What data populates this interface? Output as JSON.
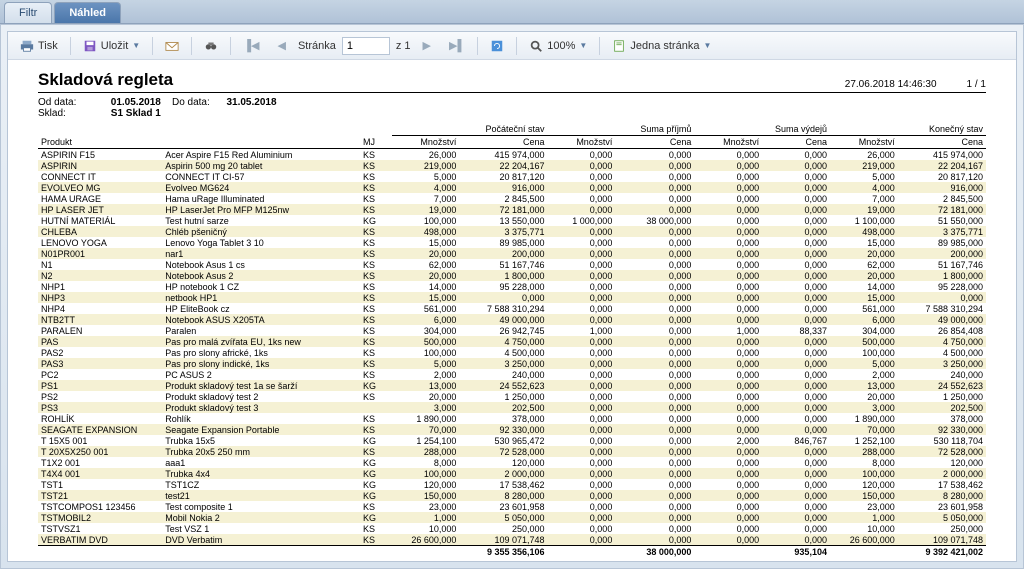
{
  "tabs": {
    "filter": "Filtr",
    "preview": "Náhled"
  },
  "toolbar": {
    "print": "Tisk",
    "save": "Uložit",
    "page_label": "Stránka",
    "page_value": "1",
    "of_label": "z 1",
    "zoom": "100%",
    "one_page": "Jedna stránka"
  },
  "report": {
    "title": "Skladová regleta",
    "generated": "27.06.2018 14:46:30",
    "pageinfo": "1 / 1",
    "meta": {
      "from_lbl": "Od data:",
      "from_val": "01.05.2018",
      "to_lbl": "Do data:",
      "to_val": "31.05.2018",
      "warehouse_lbl": "Sklad:",
      "warehouse_val": "S1 Sklad 1"
    },
    "groups": {
      "open": "Počáteční stav",
      "in": "Suma příjmů",
      "out": "Suma výdejů",
      "close": "Konečný stav"
    },
    "cols": {
      "product": "Produkt",
      "mj": "MJ",
      "qty": "Množství",
      "price": "Cena"
    },
    "rows": [
      [
        "ASPIRIN F15",
        "Acer Aspire F15 Red Aluminium",
        "KS",
        "26,000",
        "415 974,000",
        "0,000",
        "0,000",
        "0,000",
        "0,000",
        "26,000",
        "415 974,000"
      ],
      [
        "ASPIRIN",
        "Aspirin 500 mg 20 tablet",
        "KS",
        "219,000",
        "22 204,167",
        "0,000",
        "0,000",
        "0,000",
        "0,000",
        "219,000",
        "22 204,167"
      ],
      [
        "CONNECT IT",
        "CONNECT IT CI-57",
        "KS",
        "5,000",
        "20 817,120",
        "0,000",
        "0,000",
        "0,000",
        "0,000",
        "5,000",
        "20 817,120"
      ],
      [
        "EVOLVEO MG",
        "Evolveo MG624",
        "KS",
        "4,000",
        "916,000",
        "0,000",
        "0,000",
        "0,000",
        "0,000",
        "4,000",
        "916,000"
      ],
      [
        "HAMA URAGE",
        "Hama uRage Illuminated",
        "KS",
        "7,000",
        "2 845,500",
        "0,000",
        "0,000",
        "0,000",
        "0,000",
        "7,000",
        "2 845,500"
      ],
      [
        "HP LASER JET",
        "HP LaserJet Pro MFP M125nw",
        "KS",
        "19,000",
        "72 181,000",
        "0,000",
        "0,000",
        "0,000",
        "0,000",
        "19,000",
        "72 181,000"
      ],
      [
        "HUTNÍ MATERIÁL",
        "Test hutní sarze",
        "KG",
        "100,000",
        "13 550,000",
        "1 000,000",
        "38 000,000",
        "0,000",
        "0,000",
        "1 100,000",
        "51 550,000"
      ],
      [
        "CHLEBA",
        "Chléb pšeničný",
        "KS",
        "498,000",
        "3 375,771",
        "0,000",
        "0,000",
        "0,000",
        "0,000",
        "498,000",
        "3 375,771"
      ],
      [
        "LENOVO YOGA",
        "Lenovo Yoga Tablet 3 10",
        "KS",
        "15,000",
        "89 985,000",
        "0,000",
        "0,000",
        "0,000",
        "0,000",
        "15,000",
        "89 985,000"
      ],
      [
        "N01PR001",
        "nar1",
        "KS",
        "20,000",
        "200,000",
        "0,000",
        "0,000",
        "0,000",
        "0,000",
        "20,000",
        "200,000"
      ],
      [
        "N1",
        "Notebook Asus 1 cs",
        "KS",
        "62,000",
        "51 167,746",
        "0,000",
        "0,000",
        "0,000",
        "0,000",
        "62,000",
        "51 167,746"
      ],
      [
        "N2",
        "Notebook Asus 2",
        "KS",
        "20,000",
        "1 800,000",
        "0,000",
        "0,000",
        "0,000",
        "0,000",
        "20,000",
        "1 800,000"
      ],
      [
        "NHP1",
        "HP notebook 1 CZ",
        "KS",
        "14,000",
        "95 228,000",
        "0,000",
        "0,000",
        "0,000",
        "0,000",
        "14,000",
        "95 228,000"
      ],
      [
        "NHP3",
        "netbook HP1",
        "KS",
        "15,000",
        "0,000",
        "0,000",
        "0,000",
        "0,000",
        "0,000",
        "15,000",
        "0,000"
      ],
      [
        "NHP4",
        "HP EliteBook cz",
        "KS",
        "561,000",
        "7 588 310,294",
        "0,000",
        "0,000",
        "0,000",
        "0,000",
        "561,000",
        "7 588 310,294"
      ],
      [
        "NTB2TT",
        "Notebook ASUS X205TA",
        "KS",
        "6,000",
        "49 000,000",
        "0,000",
        "0,000",
        "0,000",
        "0,000",
        "6,000",
        "49 000,000"
      ],
      [
        "PARALEN",
        "Paralen",
        "KS",
        "304,000",
        "26 942,745",
        "1,000",
        "0,000",
        "1,000",
        "88,337",
        "304,000",
        "26 854,408"
      ],
      [
        "PAS",
        "Pas pro malá zvířata EU, 1ks new",
        "KS",
        "500,000",
        "4 750,000",
        "0,000",
        "0,000",
        "0,000",
        "0,000",
        "500,000",
        "4 750,000"
      ],
      [
        "PAS2",
        "Pas pro slony africké, 1ks",
        "KS",
        "100,000",
        "4 500,000",
        "0,000",
        "0,000",
        "0,000",
        "0,000",
        "100,000",
        "4 500,000"
      ],
      [
        "PAS3",
        "Pas pro slony indické, 1ks",
        "KS",
        "5,000",
        "3 250,000",
        "0,000",
        "0,000",
        "0,000",
        "0,000",
        "5,000",
        "3 250,000"
      ],
      [
        "PC2",
        "PC ASUS 2",
        "KS",
        "2,000",
        "240,000",
        "0,000",
        "0,000",
        "0,000",
        "0,000",
        "2,000",
        "240,000"
      ],
      [
        "PS1",
        "Produkt skladový test 1a se šarží",
        "KG",
        "13,000",
        "24 552,623",
        "0,000",
        "0,000",
        "0,000",
        "0,000",
        "13,000",
        "24 552,623"
      ],
      [
        "PS2",
        "Produkt skladový test 2",
        "KS",
        "20,000",
        "1 250,000",
        "0,000",
        "0,000",
        "0,000",
        "0,000",
        "20,000",
        "1 250,000"
      ],
      [
        "PS3",
        "Produkt skladový test 3",
        "",
        "3,000",
        "202,500",
        "0,000",
        "0,000",
        "0,000",
        "0,000",
        "3,000",
        "202,500"
      ],
      [
        "ROHLÍK",
        "Rohlík",
        "KS",
        "1 890,000",
        "378,000",
        "0,000",
        "0,000",
        "0,000",
        "0,000",
        "1 890,000",
        "378,000"
      ],
      [
        "SEAGATE EXPANSION",
        "Seagate Expansion Portable",
        "KS",
        "70,000",
        "92 330,000",
        "0,000",
        "0,000",
        "0,000",
        "0,000",
        "70,000",
        "92 330,000"
      ],
      [
        "T 15X5 001",
        "Trubka 15x5",
        "KG",
        "1 254,100",
        "530 965,472",
        "0,000",
        "0,000",
        "2,000",
        "846,767",
        "1 252,100",
        "530 118,704"
      ],
      [
        "T 20X5X250 001",
        "Trubka 20x5 250 mm",
        "KS",
        "288,000",
        "72 528,000",
        "0,000",
        "0,000",
        "0,000",
        "0,000",
        "288,000",
        "72 528,000"
      ],
      [
        "T1X2 001",
        "aaa1",
        "KG",
        "8,000",
        "120,000",
        "0,000",
        "0,000",
        "0,000",
        "0,000",
        "8,000",
        "120,000"
      ],
      [
        "T4X4 001",
        "Trubka 4x4",
        "KG",
        "100,000",
        "2 000,000",
        "0,000",
        "0,000",
        "0,000",
        "0,000",
        "100,000",
        "2 000,000"
      ],
      [
        "TST1",
        "TST1CZ",
        "KG",
        "120,000",
        "17 538,462",
        "0,000",
        "0,000",
        "0,000",
        "0,000",
        "120,000",
        "17 538,462"
      ],
      [
        "TST21",
        "test21",
        "KG",
        "150,000",
        "8 280,000",
        "0,000",
        "0,000",
        "0,000",
        "0,000",
        "150,000",
        "8 280,000"
      ],
      [
        "TSTCOMPOS1 123456",
        "Test composite 1",
        "KS",
        "23,000",
        "23 601,958",
        "0,000",
        "0,000",
        "0,000",
        "0,000",
        "23,000",
        "23 601,958"
      ],
      [
        "TSTMOBIL2",
        "Mobil Nokia 2",
        "KG",
        "1,000",
        "5 050,000",
        "0,000",
        "0,000",
        "0,000",
        "0,000",
        "1,000",
        "5 050,000"
      ],
      [
        "TSTVSZ1",
        "Test VSZ 1",
        "KS",
        "10,000",
        "250,000",
        "0,000",
        "0,000",
        "0,000",
        "0,000",
        "10,000",
        "250,000"
      ],
      [
        "VERBATIM DVD",
        "DVD Verbatim",
        "KS",
        "26 600,000",
        "109 071,748",
        "0,000",
        "0,000",
        "0,000",
        "0,000",
        "26 600,000",
        "109 071,748"
      ]
    ],
    "totals": {
      "open_cena": "9 355 356,106",
      "in_cena": "38 000,000",
      "out_cena": "935,104",
      "close_cena": "9 392 421,002"
    }
  }
}
